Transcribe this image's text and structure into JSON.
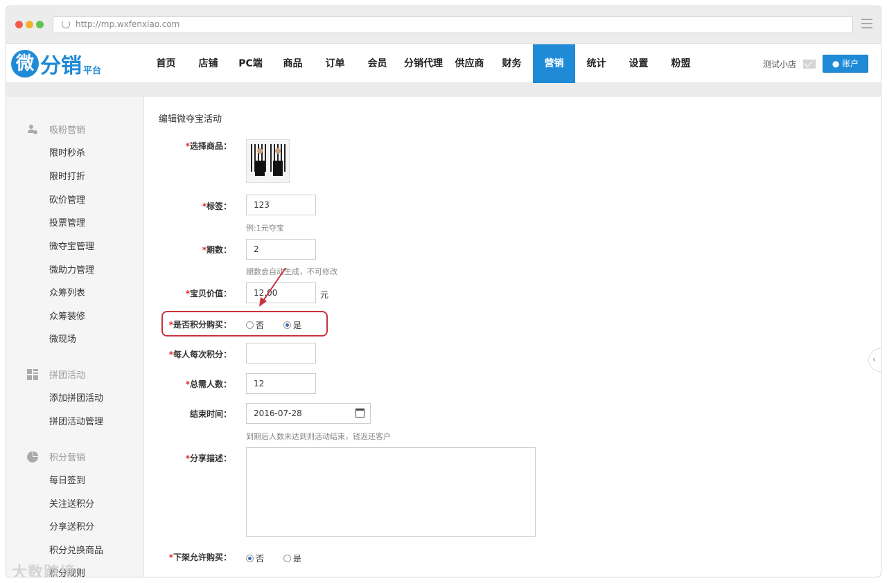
{
  "browser": {
    "url": "http://mp.wxfenxiao.com"
  },
  "header": {
    "logo_text": "微分销",
    "logo_sub": "平台",
    "nav": [
      "首页",
      "店铺",
      "PC端",
      "商品",
      "订单",
      "会员",
      "分销代理",
      "供应商",
      "财务",
      "营销",
      "统计",
      "设置",
      "粉盟"
    ],
    "active_nav": "营销",
    "shop_name": "测试小店",
    "account_label": "账户"
  },
  "sidebar": {
    "groups": [
      {
        "title": "吸粉营销",
        "icon": "user-add-icon",
        "items": [
          "限时秒杀",
          "限时打折",
          "砍价管理",
          "投票管理",
          "微夺宝管理",
          "微助力管理",
          "众筹列表",
          "众筹装修",
          "微现场"
        ]
      },
      {
        "title": "拼团活动",
        "icon": "grid-icon",
        "items": [
          "添加拼团活动",
          "拼团活动管理"
        ]
      },
      {
        "title": "积分营销",
        "icon": "pie-chart-icon",
        "items": [
          "每日签到",
          "关注送积分",
          "分享送积分",
          "积分兑换商品",
          "积分规则"
        ]
      }
    ]
  },
  "form": {
    "title": "编辑微夺宝活动",
    "product_label": "选择商品：",
    "tag_label": "标签：",
    "tag_value": "123",
    "tag_hint": "例:1元夺宝",
    "period_label": "期数：",
    "period_value": "2",
    "period_hint": "期数会自动生成，不可修改",
    "price_label": "宝贝价值：",
    "price_value": "12.00",
    "price_unit": "元",
    "points_buy_label": "是否积分购买：",
    "points_per_label": "每人每次积分：",
    "points_per_value": "",
    "total_label": "总需人数：",
    "total_value": "12",
    "end_label": "结束时间：",
    "end_value": "2016-07-28",
    "end_hint": "到期后人数未达到则活动结束，钱返还客户",
    "share_label": "分享描述：",
    "share_value": "",
    "offshelf_label": "下架允许购买：",
    "opt_no": "否",
    "opt_yes": "是",
    "points_buy_selected": "是",
    "offshelf_selected": "否"
  },
  "watermark": "大数跨境"
}
